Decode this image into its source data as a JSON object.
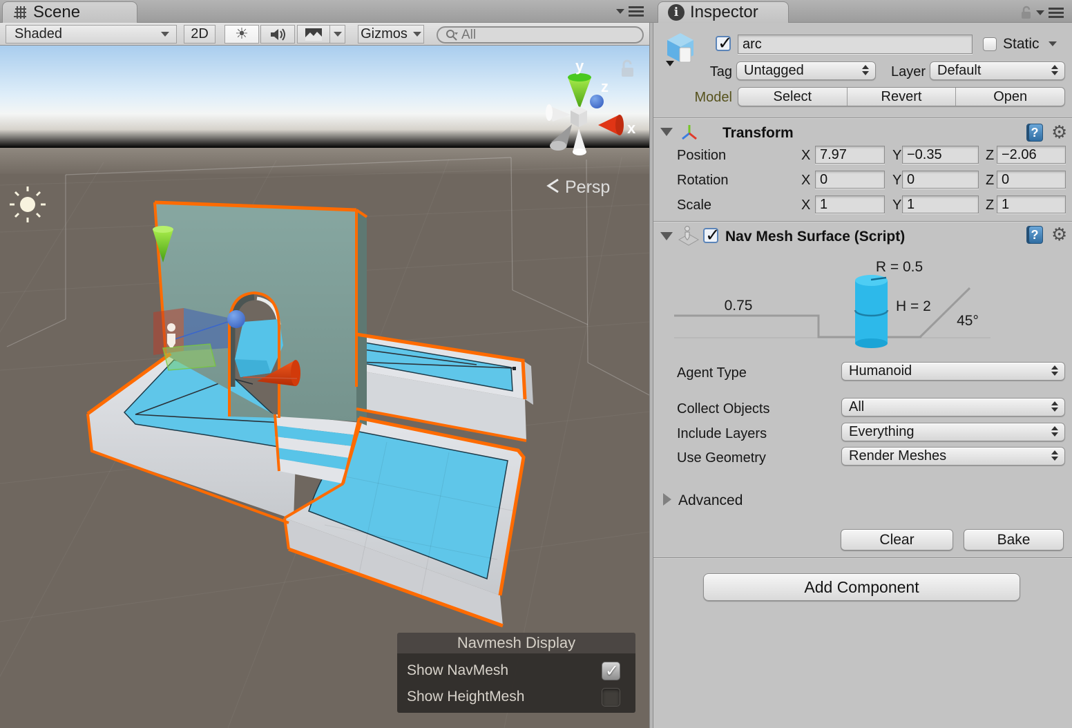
{
  "scene": {
    "tab_label": "Scene",
    "toolbar": {
      "shaded": "Shaded",
      "btn_2d": "2D",
      "gizmos": "Gizmos",
      "search_placeholder": "All"
    },
    "viewport": {
      "persp": "Persp",
      "axis": {
        "x": "x",
        "y": "y",
        "z": "z"
      },
      "overlay": {
        "title": "Navmesh Display",
        "rows": [
          {
            "label": "Show NavMesh",
            "checked": true
          },
          {
            "label": "Show HeightMesh",
            "checked": false
          }
        ]
      }
    }
  },
  "inspector": {
    "tab_label": "Inspector",
    "header": {
      "active_checked": true,
      "name_value": "arc",
      "static_label": "Static",
      "static_checked": false,
      "tag_label": "Tag",
      "tag_value": "Untagged",
      "layer_label": "Layer",
      "layer_value": "Default",
      "model_label": "Model",
      "model_buttons": [
        "Select",
        "Revert",
        "Open"
      ]
    },
    "transform": {
      "title": "Transform",
      "axis": {
        "x": "X",
        "y": "Y",
        "z": "Z"
      },
      "rows": [
        {
          "label": "Position",
          "x": "7.97",
          "y": "−0.35",
          "z": "−2.06"
        },
        {
          "label": "Rotation",
          "x": "0",
          "y": "0",
          "z": "0"
        },
        {
          "label": "Scale",
          "x": "1",
          "y": "1",
          "z": "1"
        }
      ]
    },
    "navmesh": {
      "title": "Nav Mesh Surface (Script)",
      "enabled_checked": true,
      "diagram": {
        "radius": "R = 0.5",
        "step": "0.75",
        "height": "H = 2",
        "slope": "45°"
      },
      "fields": [
        {
          "label": "Agent Type",
          "value": "Humanoid"
        },
        {
          "label": "Collect Objects",
          "value": "All"
        },
        {
          "label": "Include Layers",
          "value": "Everything"
        },
        {
          "label": "Use Geometry",
          "value": "Render Meshes"
        }
      ],
      "advanced": "Advanced",
      "clear": "Clear",
      "bake": "Bake"
    },
    "add_component": "Add Component"
  },
  "colors": {
    "selection_orange": "#ff6b00",
    "navmesh_blue": "#5fc6e9",
    "wall_teal": "#7e9e98",
    "ground": "#6f675f",
    "agent_cylinder_blue": "#2db9ea"
  }
}
